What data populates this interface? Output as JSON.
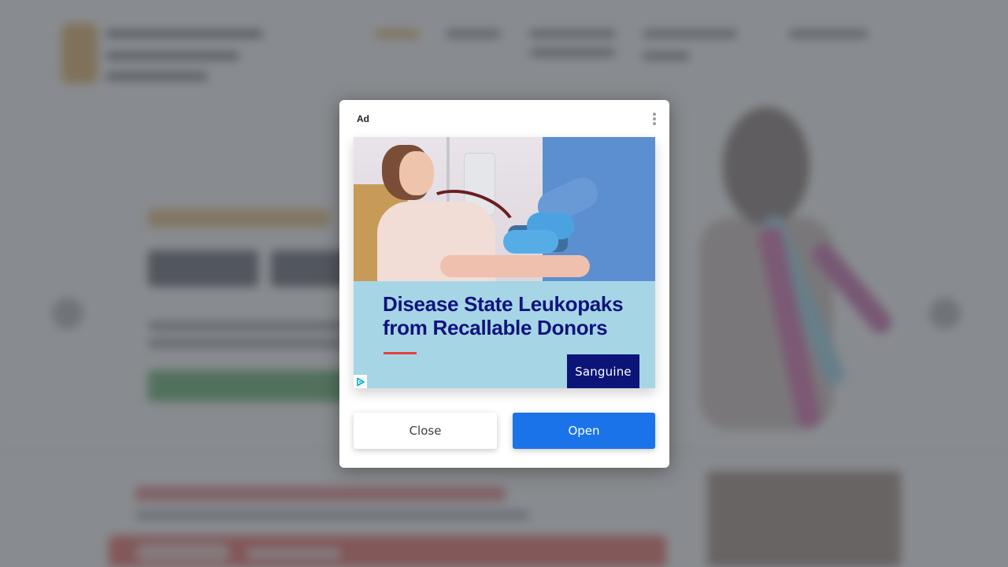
{
  "dialog": {
    "ad_label": "Ad",
    "menu_icon": "more-vert-icon",
    "creative": {
      "headline_line1": "Disease State Leukopaks",
      "headline_line2": "from Recallable Donors",
      "brand": "Sanguine",
      "adchoices_icon": "adchoices-icon"
    },
    "close_label": "Close",
    "open_label": "Open"
  },
  "colors": {
    "open_button": "#1a73e8",
    "headline": "#10137c",
    "brand_box": "#0d1478",
    "creative_background": "#a6d6e6",
    "accent_rule": "#e3403d"
  }
}
